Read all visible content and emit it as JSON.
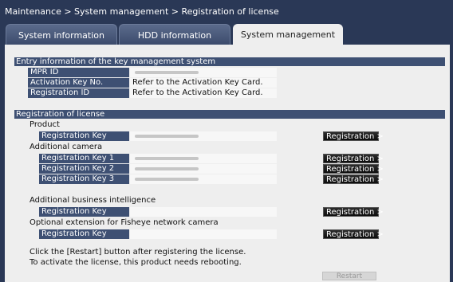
{
  "breadcrumb": "Maintenance > System management > Registration of license",
  "tabs": [
    "System information",
    "HDD information",
    "System management"
  ],
  "active_tab": "System management",
  "key_info": {
    "title": "Entry information of the key management system",
    "rows": [
      {
        "label": "MPR ID",
        "value": ""
      },
      {
        "label": "Activation Key No.",
        "value": "Refer to the Activation Key Card."
      },
      {
        "label": "Registration ID",
        "value": "Refer to the Activation Key Card."
      }
    ]
  },
  "license": {
    "title": "Registration of license",
    "product_label": "Product",
    "additional_camera_label": "Additional camera",
    "business_intelligence_label": "Additional business intelligence",
    "fisheye_label": "Optional extension for Fisheye network camera",
    "key_labels": [
      "Registration Key",
      "Registration Key 1",
      "Registration Key 2",
      "Registration Key 3",
      "Registration Key",
      "Registration Key"
    ],
    "register_button": "Registration >"
  },
  "notes": [
    "Click the [Restart] button after registering the license.",
    "To activate the license, this product needs rebooting."
  ],
  "restart_button": "Restart"
}
